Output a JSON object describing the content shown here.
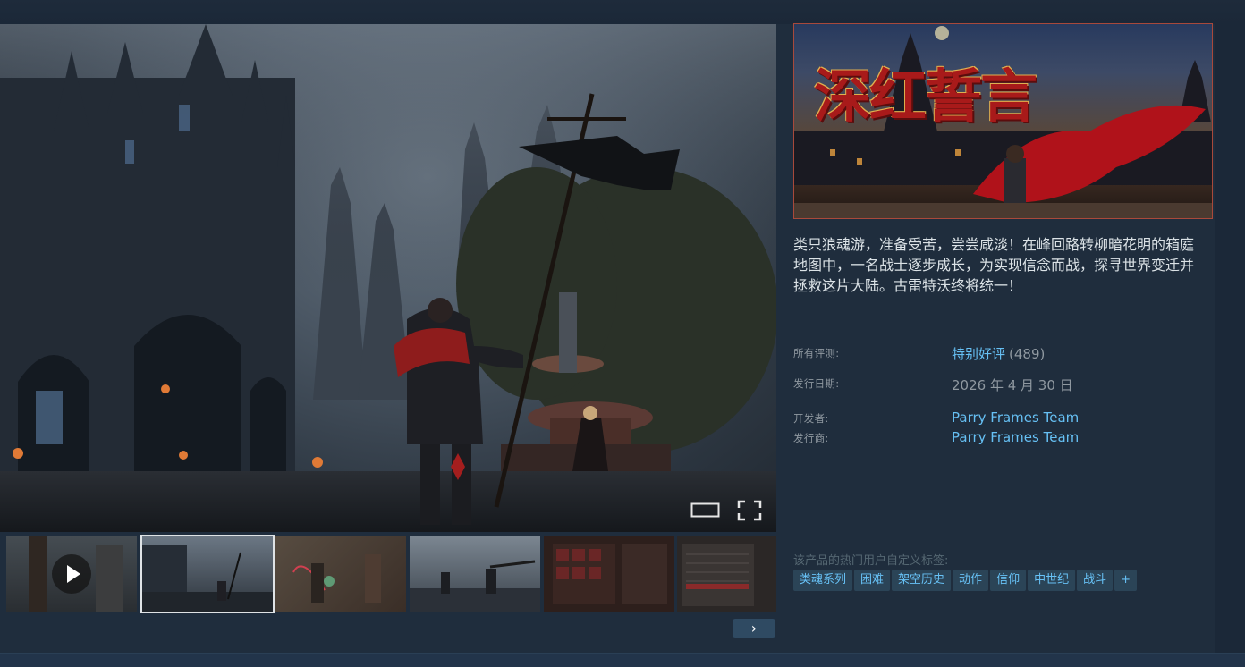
{
  "game": {
    "title": "深红誓言",
    "description": "类只狼魂游，准备受苦，尝尝咸淡！在峰回路转柳暗花明的箱庭地图中，一名战士逐步成长，为实现信念而战，探寻世界变迁并拯救这片大陆。古雷特沃终将统一！"
  },
  "reviews": {
    "label": "所有评测:",
    "summary": "特别好评",
    "count": "(489)"
  },
  "release": {
    "label": "发行日期:",
    "date": "2026 年 4 月 30 日"
  },
  "developer": {
    "label": "开发者:",
    "name": "Parry Frames Team"
  },
  "publisher": {
    "label": "发行商:",
    "name": "Parry Frames Team"
  },
  "tags": {
    "label": "该产品的热门用户自定义标签:",
    "items": [
      "类魂系列",
      "困难",
      "架空历史",
      "动作",
      "信仰",
      "中世纪",
      "战斗",
      "+"
    ]
  },
  "media": {
    "next_arrow": "›",
    "selected_index": 1
  },
  "colors": {
    "background": "#1b2838",
    "link": "#66c0f4",
    "tag_bg": "#2b4457",
    "tag_text": "#67c1f5",
    "capsule_border": "#a8493b"
  },
  "icons": [
    "windowed-icon",
    "fullscreen-icon",
    "play-icon",
    "chevron-right-icon"
  ]
}
